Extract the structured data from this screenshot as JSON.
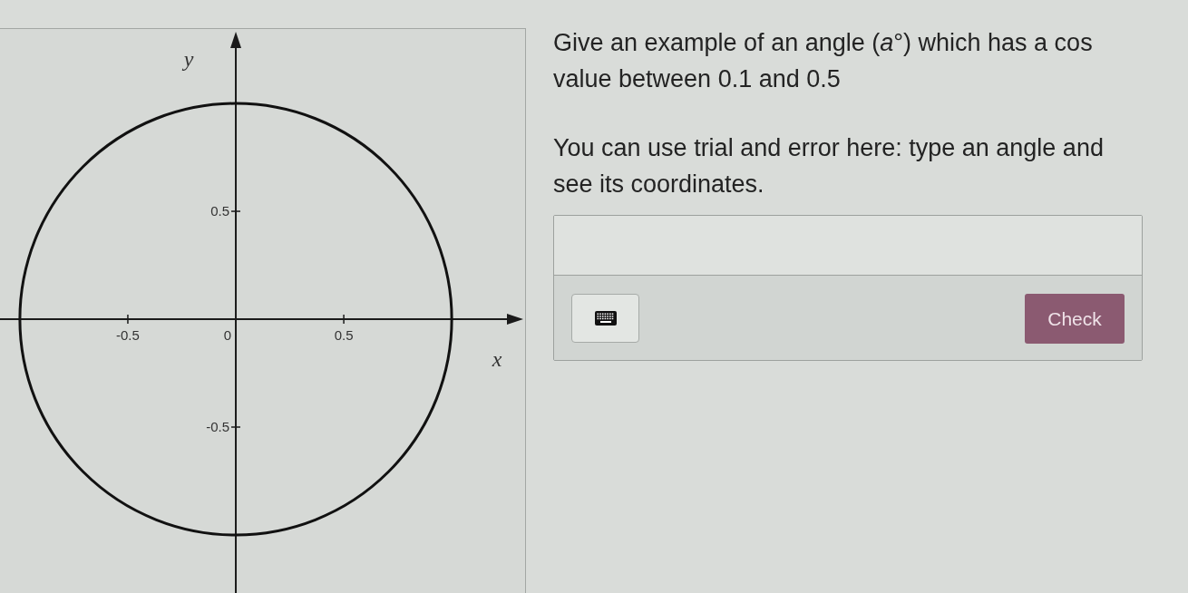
{
  "graph": {
    "chart_data": {
      "type": "line",
      "xlabel": "x",
      "ylabel": "y",
      "xlim": [
        -1.092,
        1.264
      ],
      "ylim": [
        -1.269,
        1.265
      ],
      "xticks": [
        -0.5,
        0.5
      ],
      "yticks": [
        0.5,
        -0.5
      ]
    },
    "origin_label": "0"
  },
  "question": {
    "prompt": "Give an example of an angle (*a*°) which has a cos value between 0.1 and 0.5",
    "hint": "You can use trial and error here: type an angle and see its coordinates."
  },
  "answer": {
    "check_button": "Check"
  }
}
